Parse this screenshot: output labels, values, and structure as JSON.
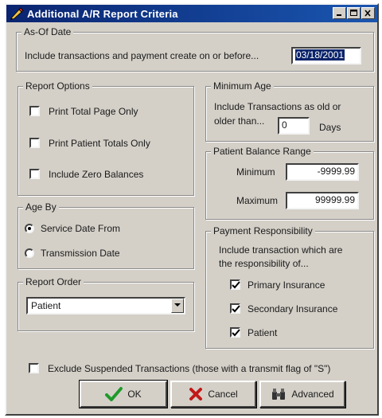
{
  "window": {
    "title": "Additional A/R Report Criteria"
  },
  "as_of": {
    "legend": "As-Of Date",
    "text": "Include transactions and payment create on or before...",
    "date": "03/18/2001"
  },
  "report_options": {
    "legend": "Report Options",
    "items": [
      {
        "label": "Print Total Page Only",
        "checked": false
      },
      {
        "label": "Print Patient Totals Only",
        "checked": false
      },
      {
        "label": "Include Zero Balances",
        "checked": false
      }
    ]
  },
  "age_by": {
    "legend": "Age By",
    "options": [
      {
        "label": "Service Date From",
        "selected": true
      },
      {
        "label": "Transmission Date",
        "selected": false
      }
    ]
  },
  "report_order": {
    "legend": "Report Order",
    "value": "Patient"
  },
  "minimum_age": {
    "legend": "Minimum Age",
    "text1": "Include Transactions as old or",
    "text2": "older than...",
    "value": "0",
    "unit": "Days"
  },
  "balance_range": {
    "legend": "Patient Balance Range",
    "min_label": "Minimum",
    "min_value": "-9999.99",
    "max_label": "Maximum",
    "max_value": "99999.99"
  },
  "payment": {
    "legend": "Payment Responsibility",
    "text1": "Include transaction which are",
    "text2": "the responsibility of...",
    "items": [
      {
        "label": "Primary Insurance",
        "checked": true
      },
      {
        "label": "Secondary Insurance",
        "checked": true
      },
      {
        "label": "Patient",
        "checked": true
      }
    ]
  },
  "exclude": {
    "label": "Exclude Suspended  Transactions (those with a transmit flag of \"S\")",
    "checked": false
  },
  "buttons": {
    "ok": "OK",
    "cancel": "Cancel",
    "advanced": "Advanced"
  }
}
